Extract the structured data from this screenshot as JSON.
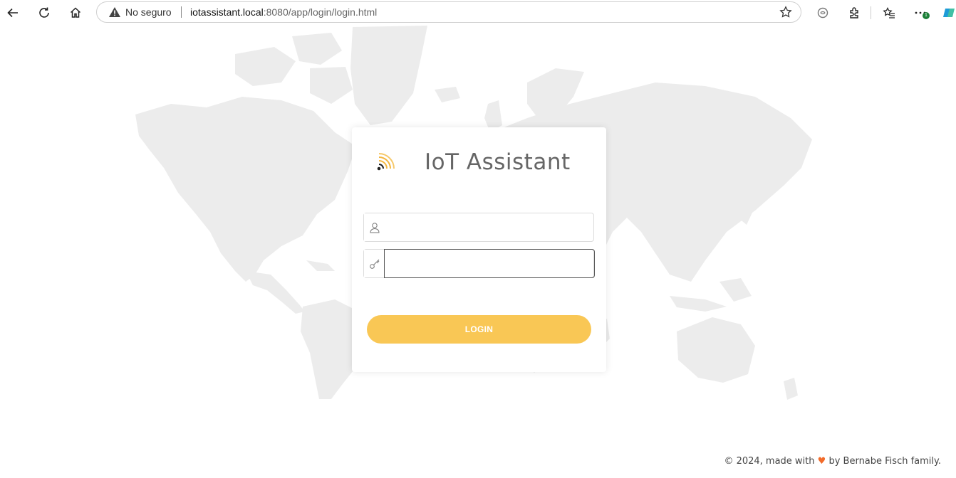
{
  "browser": {
    "security_label": "No seguro",
    "url_host": "iotassistant.local",
    "url_rest": ":8080/app/login/login.html",
    "notification_count": "1",
    "icons": [
      "back-arrow-icon",
      "reload-icon",
      "home-icon",
      "warning-icon",
      "star-icon",
      "copilot-icon",
      "extensions-icon",
      "favorites-icon",
      "more-icon",
      "edge-icon"
    ]
  },
  "login": {
    "brand": "IoT Assistant",
    "username_placeholder": "",
    "password_placeholder": "",
    "button_label": "LOGIN",
    "colors": {
      "accent": "#f9c755",
      "text": "#666666"
    }
  },
  "footer": {
    "prefix": "© 2024, made with",
    "heart": "♥",
    "suffix": "by Bernabe Fisch family."
  }
}
